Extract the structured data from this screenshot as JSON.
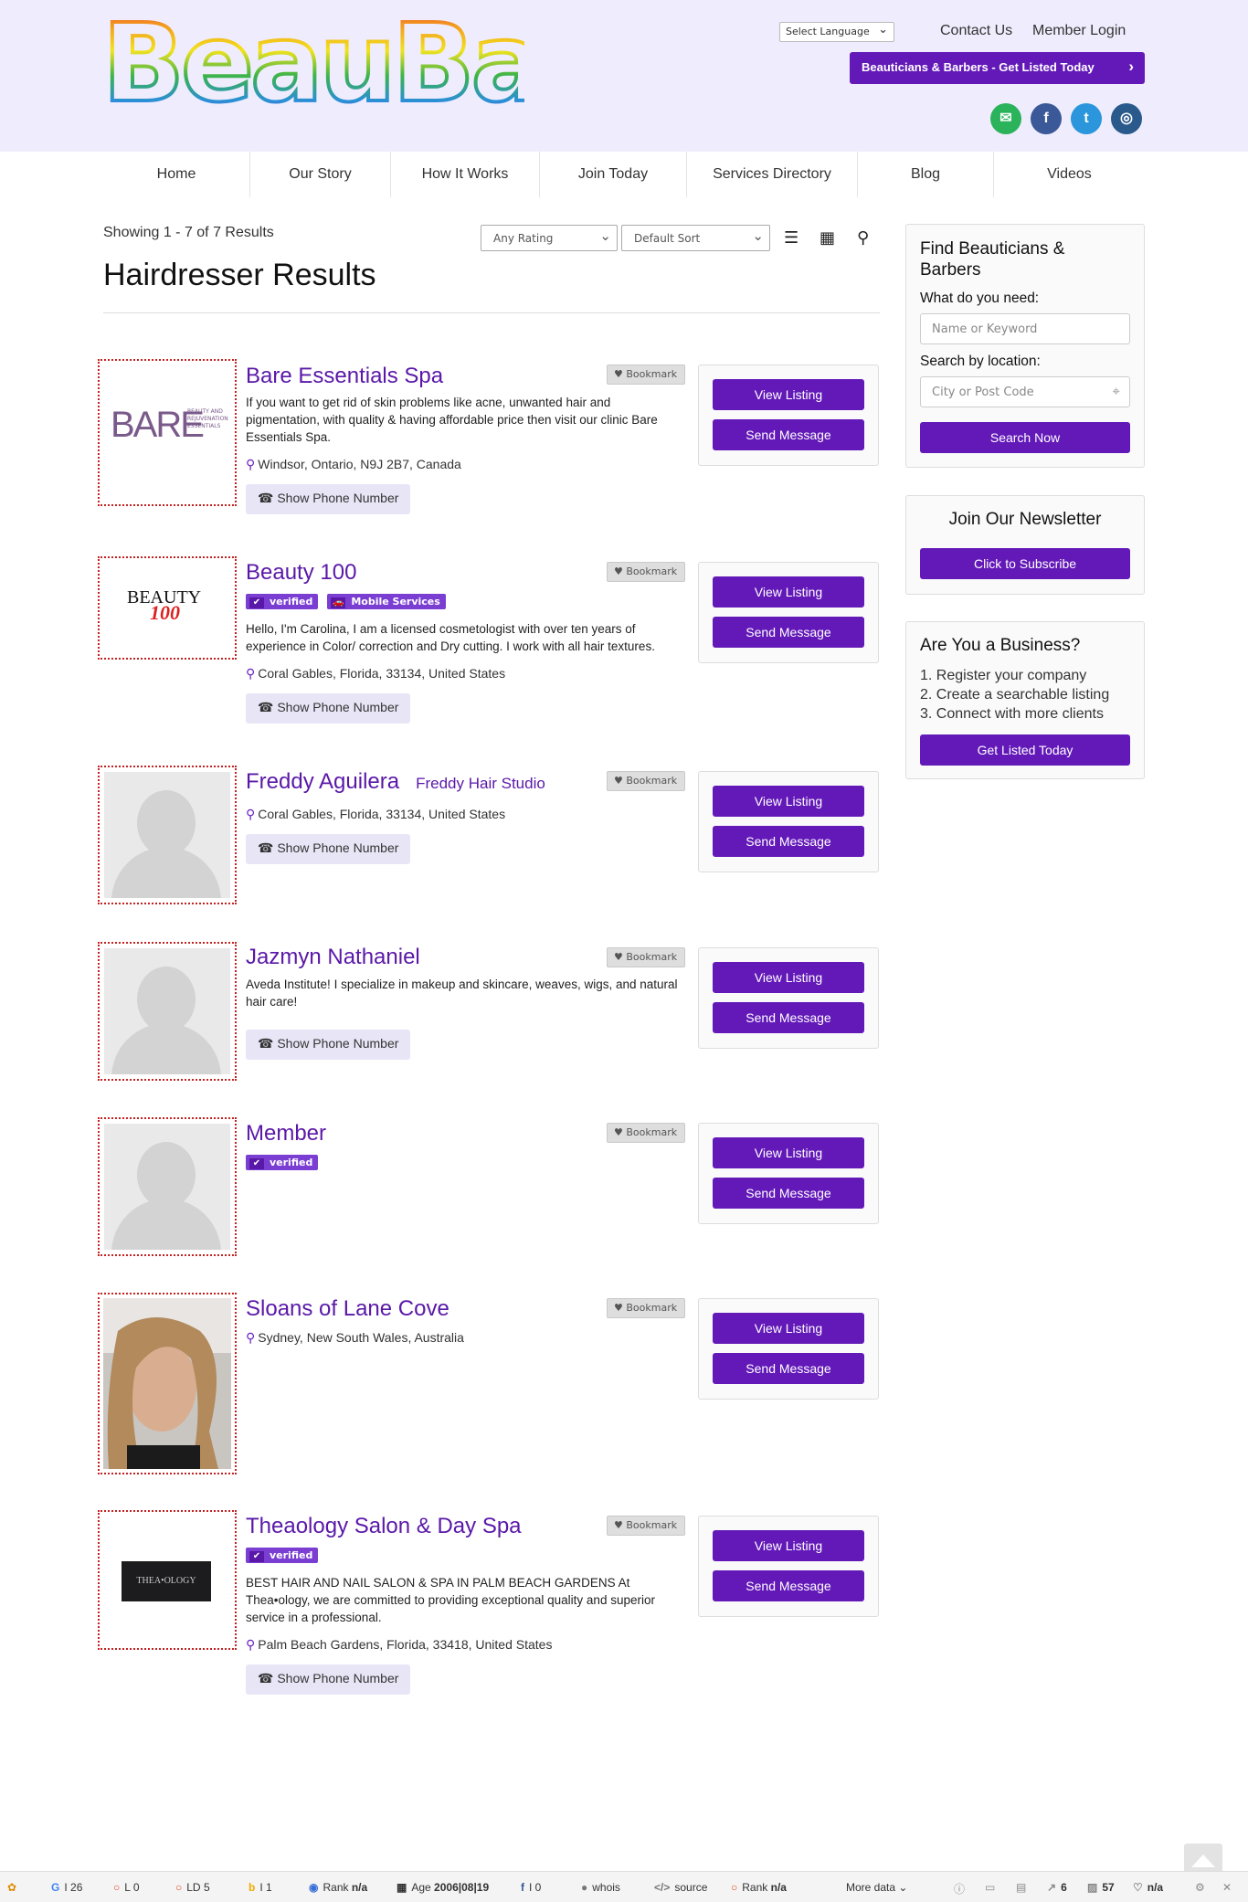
{
  "brand": {
    "logo_text": "BeauBar"
  },
  "header": {
    "language_select": "Select Language",
    "contact": "Contact Us",
    "login": "Member Login",
    "cta": "Beauticians & Barbers - Get Listed Today",
    "social": [
      "envelope-icon",
      "facebook-icon",
      "twitter-icon",
      "instagram-icon"
    ]
  },
  "nav": [
    "Home",
    "Our Story",
    "How It Works",
    "Join Today",
    "Services Directory",
    "Blog",
    "Videos"
  ],
  "results": {
    "showing": "Showing 1 - 7 of 7 Results",
    "rating_select": "Any Rating",
    "sort_select": "Default Sort",
    "title": "Hairdresser Results"
  },
  "labels": {
    "bookmark": "Bookmark",
    "view": "View Listing",
    "message": "Send Message",
    "phone": "Show Phone Number",
    "verified": "verified",
    "mobile": "Mobile Services"
  },
  "listings": [
    {
      "name": "Bare Essentials Spa",
      "desc": "If you want to get rid of skin problems like acne, unwanted hair and pigmentation, with quality & having affordable price then visit our clinic Bare Essentials Spa.",
      "address": "Windsor, Ontario, N9J 2B7, Canada",
      "logo": "BARE",
      "logo_sub": "BEAUTY AND REJUVENATION ESSENTIALS"
    },
    {
      "name": "Beauty 100",
      "desc": "Hello, I'm Carolina, I am a licensed cosmetologist with over ten years of experience in Color/ correction and Dry cutting. I work with all hair textures.",
      "address": "Coral Gables, Florida, 33134, United States",
      "logo": "BEAUTY",
      "logo_num": "100"
    },
    {
      "name": "Freddy Aguilera",
      "sub": "Freddy Hair Studio",
      "address": "Coral Gables, Florida, 33134, United States"
    },
    {
      "name": "Jazmyn Nathaniel",
      "desc": "Aveda Institute! I specialize in makeup and skincare, weaves, wigs, and natural hair care!"
    },
    {
      "name": "Member"
    },
    {
      "name": "Sloans of Lane Cove",
      "address": "Sydney, New South Wales, Australia"
    },
    {
      "name": "Theaology Salon & Day Spa",
      "desc": "BEST HAIR AND NAIL SALON & SPA IN PALM BEACH GARDENS At Thea•ology, we are committed to providing exceptional quality and superior service in a professional.",
      "address": "Palm Beach Gardens, Florida, 33418, United States",
      "logo": "THEA•OLOGY"
    }
  ],
  "sidebar": {
    "find": {
      "title": "Find Beauticians & Barbers",
      "need_label": "What do you need:",
      "need_placeholder": "Name or Keyword",
      "loc_label": "Search by location:",
      "loc_placeholder": "City or Post Code",
      "button": "Search Now"
    },
    "newsletter": {
      "title": "Join Our Newsletter",
      "button": "Click to Subscribe"
    },
    "business": {
      "title": "Are You a Business?",
      "steps": [
        "1. Register your company",
        "2. Create a searchable listing",
        "3. Connect with more clients"
      ],
      "button": "Get Listed Today"
    }
  },
  "statusbar": {
    "g": "26",
    "l": "0",
    "ld": "5",
    "b": "1",
    "rank1": "n/a",
    "age": "2006|08|19",
    "fb": "0",
    "whois": "whois",
    "source": "source",
    "rank2": "n/a",
    "more": "More data",
    "links": "6",
    "pages": "57",
    "heart": "n/a",
    "labels": {
      "l": "L",
      "ld": "LD",
      "rank": "Rank",
      "age": "Age"
    }
  },
  "colors": {
    "brand": "#6319b8",
    "header_bg": "#efedfd",
    "link": "#5a18a8"
  }
}
